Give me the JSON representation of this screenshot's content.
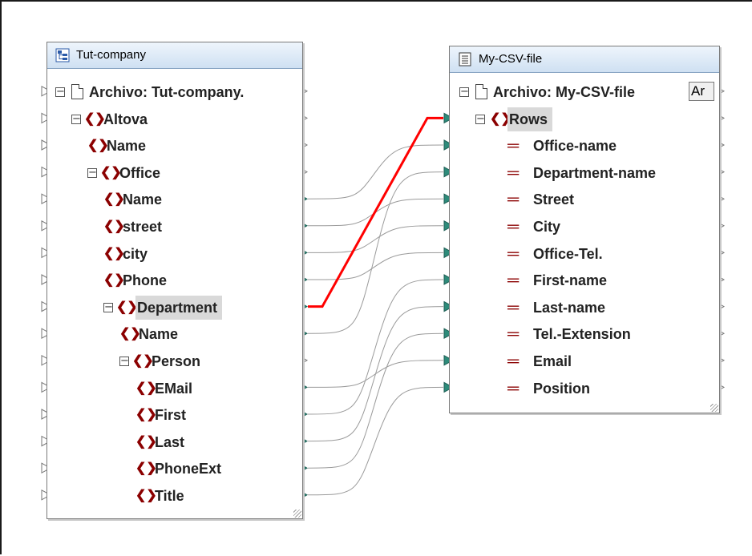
{
  "source_component": {
    "title": "Tut-company",
    "icon": "schema-icon",
    "file_label": "Archivo: Tut-company.",
    "items": [
      {
        "label": "Altova",
        "type": "element",
        "depth": 1,
        "expander": "⊟"
      },
      {
        "label": "Name",
        "type": "element",
        "depth": 2
      },
      {
        "label": "Office",
        "type": "element",
        "depth": 2,
        "expander": "⊟"
      },
      {
        "label": "Name",
        "type": "element",
        "depth": 3
      },
      {
        "label": "street",
        "type": "element",
        "depth": 3
      },
      {
        "label": "city",
        "type": "element",
        "depth": 3
      },
      {
        "label": "Phone",
        "type": "element",
        "depth": 3
      },
      {
        "label": "Department",
        "type": "element",
        "depth": 3,
        "expander": "⊟",
        "selected": true
      },
      {
        "label": "Name",
        "type": "element",
        "depth": 4
      },
      {
        "label": "Person",
        "type": "element",
        "depth": 4,
        "expander": "⊟"
      },
      {
        "label": "EMail",
        "type": "element",
        "depth": 5
      },
      {
        "label": "First",
        "type": "element",
        "depth": 5
      },
      {
        "label": "Last",
        "type": "element",
        "depth": 5
      },
      {
        "label": "PhoneExt",
        "type": "element",
        "depth": 5
      },
      {
        "label": "Title",
        "type": "element",
        "depth": 5
      }
    ]
  },
  "target_component": {
    "title": "My-CSV-file",
    "icon": "csv-file-icon",
    "file_label": "Archivo: My-CSV-file",
    "file_button": "Ar",
    "rows_label": "Rows",
    "fields": [
      "Office-name",
      "Department-name",
      "Street",
      "City",
      "Office-Tel.",
      "First-name",
      "Last-name",
      "Tel.-Extension",
      "Email",
      "Position"
    ]
  },
  "connections": [
    {
      "from": "Department",
      "to": "Rows",
      "highlighted": true
    },
    {
      "from": "Office/Name",
      "to": "Office-name"
    },
    {
      "from": "Department/Name",
      "to": "Department-name"
    },
    {
      "from": "street",
      "to": "Street"
    },
    {
      "from": "city",
      "to": "City"
    },
    {
      "from": "Phone",
      "to": "Office-Tel."
    },
    {
      "from": "First",
      "to": "First-name"
    },
    {
      "from": "Last",
      "to": "Last-name"
    },
    {
      "from": "PhoneExt",
      "to": "Tel.-Extension"
    },
    {
      "from": "EMail",
      "to": "Email"
    },
    {
      "from": "Title",
      "to": "Position"
    }
  ],
  "colors": {
    "highlight_wire": "#ff0000",
    "wire": "#9a9a9a",
    "connector_filled": "#2e8b7a",
    "element_icon": "#8b0000"
  }
}
